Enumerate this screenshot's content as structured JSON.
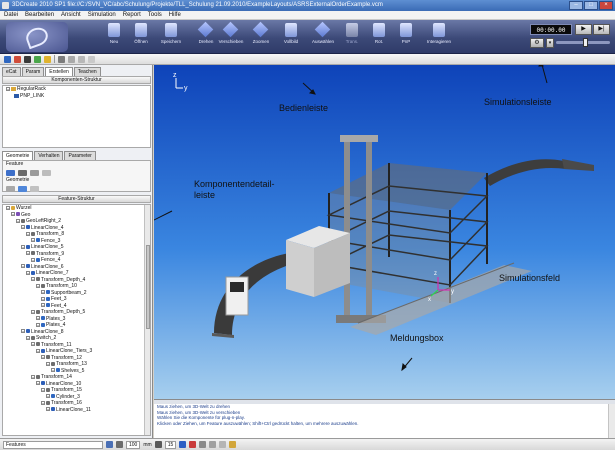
{
  "window": {
    "title": "3DCreate 2010 SP1 file://C:/SVN_VC/abc/Schulung/Projekte/TLL_Schulung 21.09.2010/ExampleLayouts/ASRSExternalOrderExample.vcm"
  },
  "menu": [
    "Datei",
    "Bearbeiten",
    "Ansicht",
    "Simulation",
    "Report",
    "Tools",
    "Hilfe"
  ],
  "ribbon": {
    "buttons": [
      "Neu",
      "Öffnen",
      "Speichern",
      "Drehen",
      "Verschieben",
      "Zoomen",
      "Vollbild",
      "Auswählen",
      "Trans.",
      "Rot.",
      "PnP",
      "Interagieren"
    ],
    "accent_color": "#3c4978"
  },
  "sim": {
    "time": "00:00.00",
    "play_icon": "▶",
    "end_icon": "▶|",
    "speed": 0.55
  },
  "left": {
    "tabs": [
      "eCat",
      "Param",
      "Erstellen",
      "Teachen"
    ],
    "component_header": "Komponenten-Struktur",
    "component_tree": [
      "RegularRack",
      "PNP_LINK"
    ],
    "sub_tabs": [
      "Geometrie",
      "Verhalten",
      "Parameter"
    ],
    "feature_label": "Feature",
    "geometry_label": "Geometrie",
    "feature_header": "Feature-Struktur",
    "feature_tree": [
      "Wurzel",
      "Geo",
      "GeoLeftRight_2",
      "LinearClone_4",
      "Transform_8",
      "Fence_3",
      "LinearClone_5",
      "Transform_9",
      "Fence_4",
      "LinearClone_6",
      "LinearClone_7",
      "Transform_Depth_4",
      "Transform_10",
      "Supportbeam_2",
      "Feet_3",
      "Feet_4",
      "Transform_Depth_5",
      "Plates_3",
      "Plates_4",
      "LinearClone_8",
      "Switch_2",
      "Transform_11",
      "LinearClone_Tiers_3",
      "Transform_12",
      "Transform_13",
      "Shelves_5",
      "Transform_14",
      "LinearClone_10",
      "Transform_15",
      "Cylinder_3",
      "Transform_16",
      "LinearClone_11"
    ]
  },
  "annotations": {
    "bedienleiste": "Bedienleiste",
    "simulationsleiste": "Simulationsleiste",
    "komponentendetail_1": "Komponentendetail-",
    "komponentendetail_2": "leiste",
    "simulationsfeld": "Simulationsfeld",
    "meldungsbox": "Meldungsbox"
  },
  "axes": {
    "z": "z",
    "y": "y",
    "x": "x"
  },
  "messages": [
    "Maus ziehen, um 3D-Welt zu drehen",
    "Maus ziehen, um 3D-Welt zu verschieben",
    "Wählen Sie die Komponente für plug-n-play.",
    "Klicken oder Ziehen, um Feature auszuwählen; Shift+Ctrl gedrückt halten, um mehrere auszuwählen."
  ],
  "status": {
    "mode": "Features",
    "zoom": "100",
    "unit": "mm",
    "grid": "15"
  }
}
